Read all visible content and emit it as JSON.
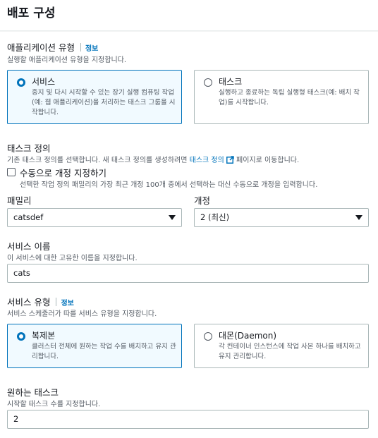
{
  "section_title": "배포 구성",
  "application_type": {
    "label": "애플리케이션 유형",
    "info": "정보",
    "description": "실행할 애플리케이션 유형을 지정합니다.",
    "options": [
      {
        "title": "서비스",
        "description": "중지 및 다시 시작할 수 있는 장기 실행 컴퓨팅 작업(예: 웹 애플리케이션)을 처리하는 태스크 그룹을 시작합니다.",
        "selected": true
      },
      {
        "title": "태스크",
        "description": "실행하고 종료하는 독립 실행형 태스크(예: 배치 작업)를 시작합니다.",
        "selected": false
      }
    ]
  },
  "task_definition": {
    "label": "태스크 정의",
    "description_prefix": "기존 태스크 정의를 선택합니다. 새 태스크 정의를 생성하려면",
    "link_text": "태스크 정의",
    "description_suffix": "페이지로 이동합니다.",
    "manual_revision": {
      "label": "수동으로 개정 지정하기",
      "description": "선택한 작업 정의 패밀리의 가장 최근 개정 100개 중에서 선택하는 대신 수동으로 개정을 입력합니다.",
      "checked": false
    },
    "family": {
      "label": "패밀리",
      "value": "catsdef"
    },
    "revision": {
      "label": "개정",
      "value": "2 (최신)"
    }
  },
  "service_name": {
    "label": "서비스 이름",
    "description": "이 서비스에 대한 고유한 이름을 지정합니다.",
    "value": "cats"
  },
  "service_type": {
    "label": "서비스 유형",
    "info": "정보",
    "description": "서비스 스케줄러가 따를 서비스 유형을 지정합니다.",
    "options": [
      {
        "title": "복제본",
        "description": "클러스터 전체에 원하는 작업 수를 배치하고 유지 관리합니다.",
        "selected": true
      },
      {
        "title": "대몬(Daemon)",
        "description": "각 컨테이너 인스턴스에 작업 사본 하나를 배치하고 유지 관리합니다.",
        "selected": false
      }
    ]
  },
  "desired_tasks": {
    "label": "원하는 태스크",
    "description": "시작할 태스크 수를 지정합니다.",
    "value": "2"
  },
  "colors": {
    "accent": "#0073bb",
    "border": "#aab7b8",
    "muted_text": "#545b64"
  }
}
